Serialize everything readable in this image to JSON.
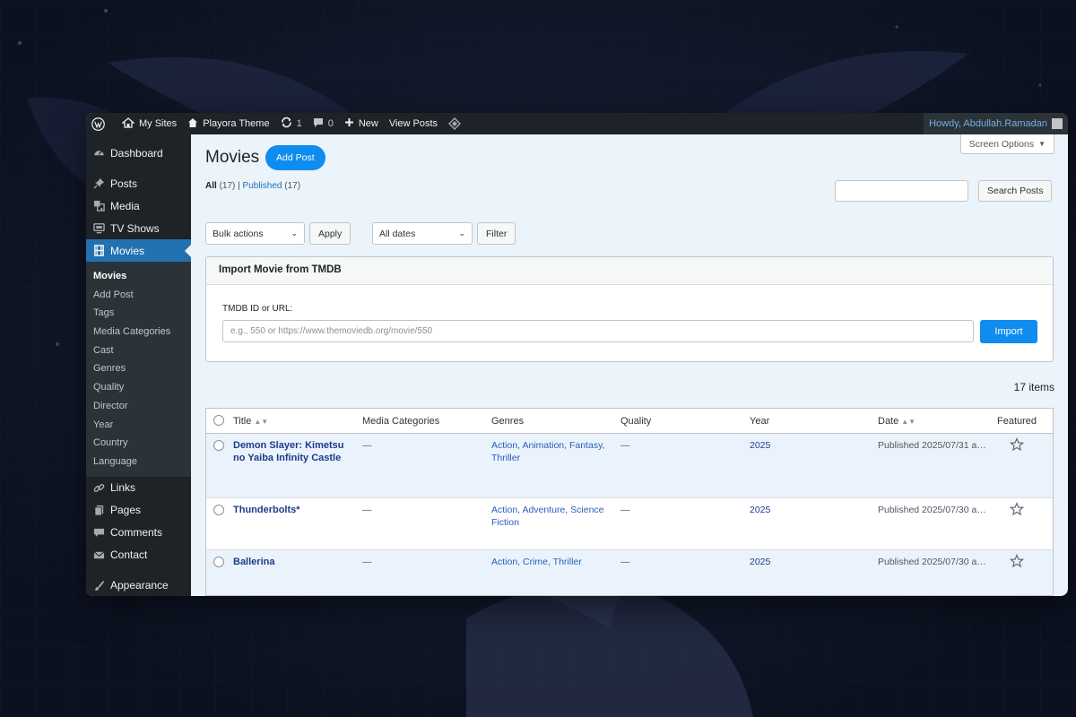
{
  "colors": {
    "adminbar": "#1d2327",
    "sidebar": "#1d2327",
    "accent": "#0e8cef",
    "current_menu": "#2271b1",
    "content_bg": "#ebf3fb",
    "link": "#2271b1",
    "title_link": "#1e3a8a"
  },
  "adminbar": {
    "items": [
      {
        "label": "My Sites",
        "icon": "my-sites-icon"
      },
      {
        "label": "Playora Theme",
        "icon": "home-icon"
      },
      {
        "label": "1",
        "icon": "updates-icon"
      },
      {
        "label": "0",
        "icon": "comments-icon"
      },
      {
        "label": "New",
        "icon": "plus-icon"
      },
      {
        "label": "View Posts"
      }
    ],
    "howdy": "Howdy, Abdullah.Ramadan"
  },
  "sidebar": {
    "menu": [
      {
        "label": "Dashboard",
        "icon": "dashboard-icon"
      },
      {
        "label": "Posts",
        "icon": "pin-icon"
      },
      {
        "label": "Media",
        "icon": "media-icon"
      },
      {
        "label": "TV Shows",
        "icon": "tv-icon"
      },
      {
        "label": "Movies",
        "icon": "film-icon",
        "current": true
      },
      {
        "label": "Links",
        "icon": "link-icon"
      },
      {
        "label": "Pages",
        "icon": "pages-icon"
      },
      {
        "label": "Comments",
        "icon": "comment-icon"
      },
      {
        "label": "Contact",
        "icon": "mail-icon"
      },
      {
        "label": "Appearance",
        "icon": "brush-icon"
      }
    ],
    "submenu": [
      "Movies",
      "Add Post",
      "Tags",
      "Media Categories",
      "Cast",
      "Genres",
      "Quality",
      "Director",
      "Year",
      "Country",
      "Language"
    ]
  },
  "header": {
    "screen_options": "Screen Options",
    "title": "Movies",
    "add_post": "Add Post"
  },
  "views": {
    "all_label": "All",
    "all_count": "(17)",
    "separator": "|",
    "published_label": "Published",
    "published_count": "(17)"
  },
  "search": {
    "placeholder": "",
    "button": "Search Posts"
  },
  "bulk": {
    "select": "Bulk actions",
    "apply": "Apply",
    "dates": "All dates",
    "filter": "Filter"
  },
  "import": {
    "heading": "Import Movie from TMDB",
    "label": "TMDB ID or URL:",
    "placeholder": "e.g., 550 or https://www.themoviedb.org/movie/550",
    "button": "Import"
  },
  "table": {
    "count_label": "17 items",
    "columns": [
      "Title",
      "Media Categories",
      "Genres",
      "Quality",
      "Year",
      "Date",
      "Featured"
    ],
    "rows": [
      {
        "title": "Demon Slayer: Kimetsu no Yaiba Infinity Castle",
        "media": "—",
        "genres": "Action, Animation, Fantasy, Thriller",
        "quality": "—",
        "year": "2025",
        "date": "Published 2025/07/31 at ...",
        "featured": false
      },
      {
        "title": "Thunderbolts*",
        "media": "—",
        "genres": "Action, Adventure, Science Fiction",
        "quality": "—",
        "year": "2025",
        "date": "Published 2025/07/30 at ...",
        "featured": false
      },
      {
        "title": "Ballerina",
        "media": "—",
        "genres": "Action, Crime, Thriller",
        "quality": "—",
        "year": "2025",
        "date": "Published 2025/07/30 at ...",
        "featured": false
      }
    ]
  }
}
